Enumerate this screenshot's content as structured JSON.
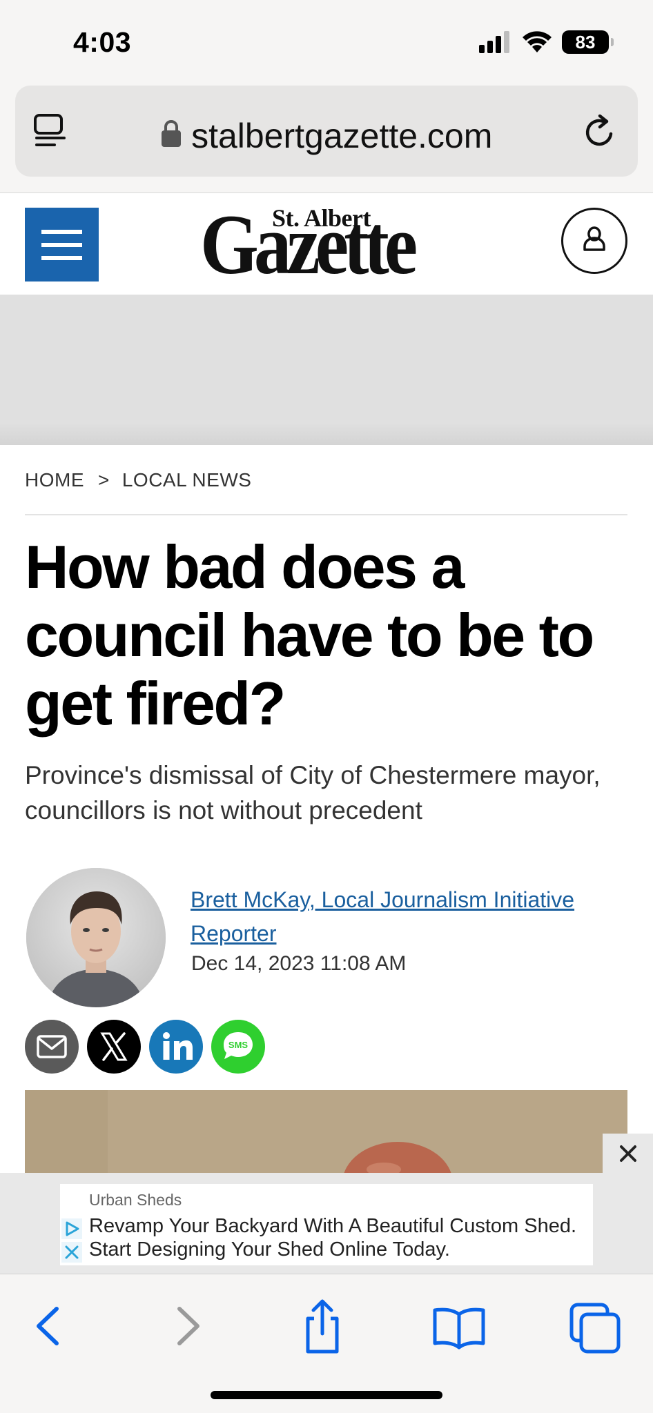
{
  "status_bar": {
    "time": "4:03",
    "battery": "83"
  },
  "browser": {
    "url": "stalbertgazette.com"
  },
  "site": {
    "logo_small": "St. Albert",
    "logo_big": "Gazette"
  },
  "breadcrumb": {
    "home": "HOME",
    "separator": ">",
    "section": "LOCAL NEWS"
  },
  "article": {
    "headline": "How bad does a council have to be to get fired?",
    "subhead": "Province's dismissal of City of Chestermere mayor, councillors is not without precedent",
    "author": "Brett McKay, Local Journalism Initiative Reporter",
    "date": "Dec 14, 2023 11:08 AM"
  },
  "share": {
    "sms_label": "SMS"
  },
  "ad": {
    "advertiser": "Urban Sheds",
    "text": "Revamp Your Backyard With A Beautiful Custom Shed. Start Designing Your Shed Online Today.",
    "close_symbol": "×"
  },
  "colors": {
    "brand_blue": "#1a64ad",
    "link_blue": "#1a5f9e",
    "ios_blue": "#0a64e8",
    "sms_green": "#2fcf2f",
    "linkedin_blue": "#1878b8"
  },
  "icons": [
    "reader-icon",
    "lock-icon",
    "reload-icon",
    "hamburger-icon",
    "user-icon",
    "email-icon",
    "x-logo-icon",
    "linkedin-icon",
    "sms-icon",
    "close-icon",
    "adchoices-icon",
    "back-icon",
    "forward-icon",
    "share-icon",
    "bookmarks-icon",
    "tabs-icon"
  ]
}
